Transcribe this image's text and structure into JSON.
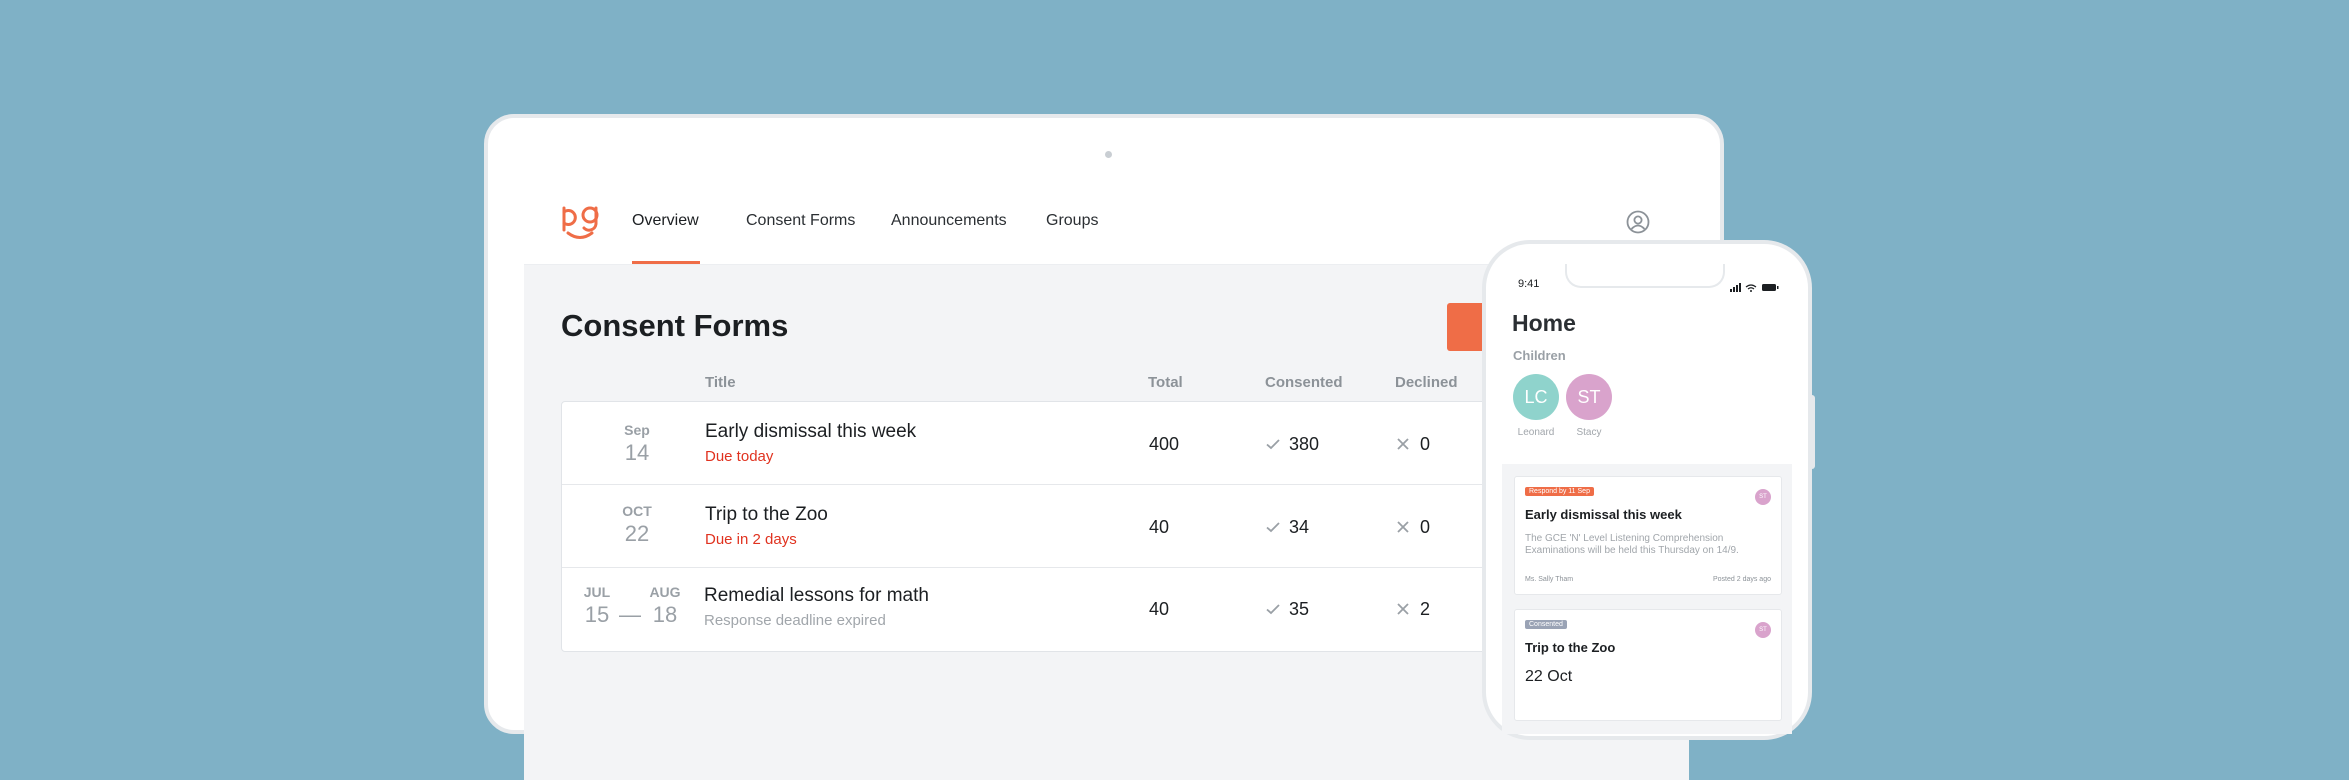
{
  "nav": {
    "items": [
      {
        "label": "Overview",
        "active": true
      },
      {
        "label": "Consent Forms",
        "active": false
      },
      {
        "label": "Announcements",
        "active": false
      },
      {
        "label": "Groups",
        "active": false
      }
    ],
    "accent": "#ef6d47",
    "profile_icon": "user-circle-icon"
  },
  "page": {
    "title": "Consent Forms",
    "columns": [
      "Title",
      "Total",
      "Consented",
      "Declined"
    ]
  },
  "rows": [
    {
      "month": "Sep",
      "day": "14",
      "title": "Early dismissal this week",
      "status": "Due today",
      "status_type": "due",
      "total": "400",
      "consented": "380",
      "declined": "0"
    },
    {
      "month": "OCT",
      "day": "22",
      "title": "Trip to the Zoo",
      "status": "Due in 2 days",
      "status_type": "due",
      "total": "40",
      "consented": "34",
      "declined": "0"
    },
    {
      "month_start": "JUL",
      "day_start": "15",
      "range_sep": "—",
      "month_end": "AUG",
      "day_end": "18",
      "title": "Remedial lessons for math",
      "status": "Response deadline expired",
      "status_type": "expired",
      "total": "40",
      "consented": "35",
      "declined": "2"
    }
  ],
  "phone": {
    "time": "9:41",
    "title": "Home",
    "subtitle": "Children",
    "children": [
      {
        "initials": "LC",
        "name": "Leonard",
        "color": "#8fd3cc"
      },
      {
        "initials": "ST",
        "name": "Stacy",
        "color": "#d9a3cc"
      }
    ],
    "cards": [
      {
        "badge": "Respond by 11 Sep",
        "badge_color": "#ef6d47",
        "title": "Early dismissal this week",
        "text": "The GCE 'N' Level Listening Comprehension Examinations will be held this Thursday on 14/9.",
        "author": "Ms. Sally Tham",
        "posted": "Posted 2 days ago",
        "avatar": "ST"
      },
      {
        "badge": "Consented",
        "badge_color": "#9aa3b5",
        "title": "Trip to the Zoo",
        "date": "22 Oct",
        "avatar": "ST"
      }
    ]
  }
}
